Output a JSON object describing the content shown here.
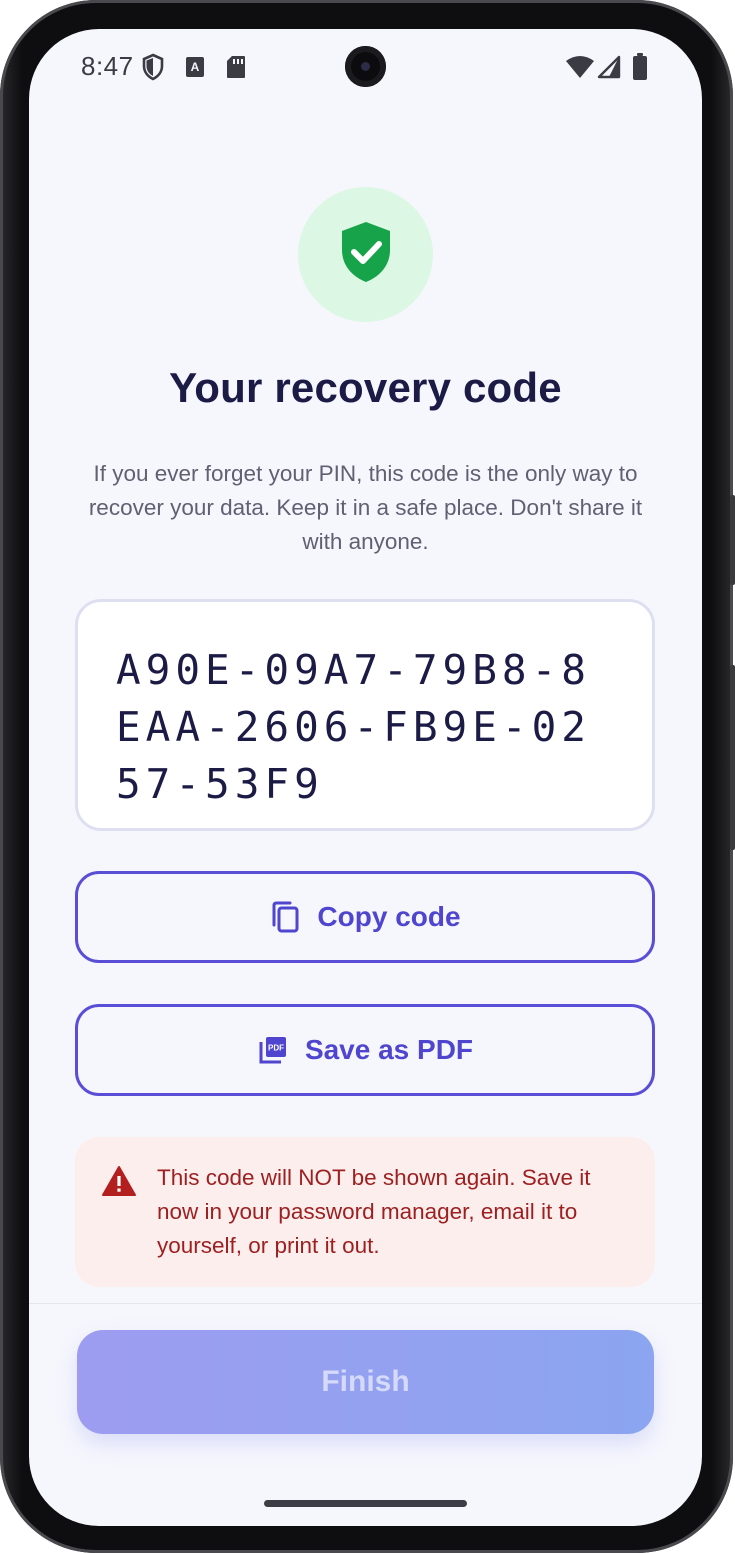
{
  "status_bar": {
    "time": "8:47",
    "left_icons": [
      "shield-icon",
      "font-a-icon",
      "sd-card-icon"
    ],
    "right_icons": [
      "wifi-icon",
      "cellular-signal-icon",
      "battery-icon"
    ]
  },
  "header": {
    "badge_icon": "shield-check-icon",
    "title": "Your recovery code",
    "description": "If you ever forget your PIN, this code is the only way to recover your data. Keep it in a safe place. Don't share it with anyone."
  },
  "recovery_code": "A90E-09A7-79B8-8EAA-2606-FB9E-0257-53F9",
  "actions": {
    "copy_label": "Copy code",
    "copy_icon": "copy-icon",
    "pdf_label": "Save as PDF",
    "pdf_icon": "pdf-icon"
  },
  "warning": {
    "icon": "warning-triangle-icon",
    "text": "This code will NOT be shown again. Save it now in your password manager, email it to yourself, or print it out."
  },
  "footer": {
    "finish_label": "Finish"
  },
  "colors": {
    "accent": "#4f45cf",
    "title": "#1c1b46",
    "success_bg": "#dcf7e3",
    "success": "#16a34a",
    "warning_bg": "#fdeeee",
    "warning_text": "#9d1f1f",
    "finish_gradient_start": "#9d9cf0",
    "finish_gradient_end": "#8ba5f0"
  }
}
